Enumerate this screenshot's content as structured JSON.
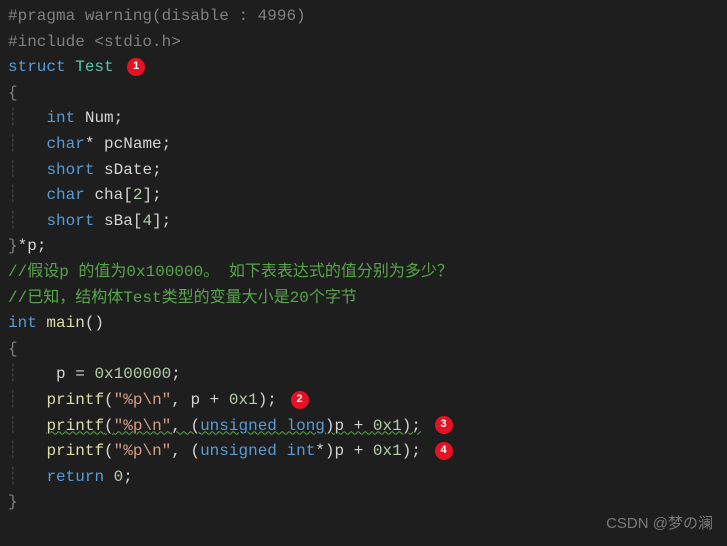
{
  "code": {
    "l1_pragma": "#pragma warning(disable : 4996)",
    "l2_include_kw": "#include ",
    "l2_include_hdr": "<stdio.h>",
    "l3_struct": "struct",
    "l3_name": "Test",
    "l4_brace": "{",
    "l5_type": "int",
    "l5_id": " Num;",
    "l6_type": "char",
    "l6_id": "* pcName;",
    "l7_type": "short",
    "l7_id": " sDate;",
    "l8_type": "char",
    "l8_id": " cha[",
    "l8_num": "2",
    "l8_end": "];",
    "l9_type": "short",
    "l9_id": " sBa[",
    "l9_num": "4",
    "l9_end": "];",
    "l10_close": "}*p;",
    "l11_comment": "//假设p 的值为0x100000。 如下表表达式的值分别为多少？",
    "l12_comment": "//已知，结构体Test类型的变量大小是20个字节",
    "l13_type": "int",
    "l13_main": " main",
    "l13_paren": "()",
    "l14_brace": "{",
    "l15_assign": "    p = ",
    "l15_num": "0x100000",
    "l15_end": ";",
    "l16_printf": "printf",
    "l16_open": "(",
    "l16_str": "\"%p\\n\"",
    "l16_mid": ", p + ",
    "l16_hex": "0x1",
    "l16_close": ");",
    "l17_printf": "printf",
    "l17_open": "(",
    "l17_str": "\"%p\\n\"",
    "l17_mid": ", (",
    "l17_cast": "unsigned long",
    "l17_castend": ")p + ",
    "l17_hex": "0x1",
    "l17_close": ");",
    "l18_printf": "printf",
    "l18_open": "(",
    "l18_str": "\"%p\\n\"",
    "l18_mid": ", (",
    "l18_cast": "unsigned int",
    "l18_castend": "*)p + ",
    "l18_hex": "0x1",
    "l18_close": ");",
    "l19_return": "return",
    "l19_val": " 0",
    "l19_end": ";",
    "l20_brace": "}"
  },
  "badges": {
    "b1": "1",
    "b2": "2",
    "b3": "3",
    "b4": "4"
  },
  "watermark": "CSDN @梦の澜"
}
